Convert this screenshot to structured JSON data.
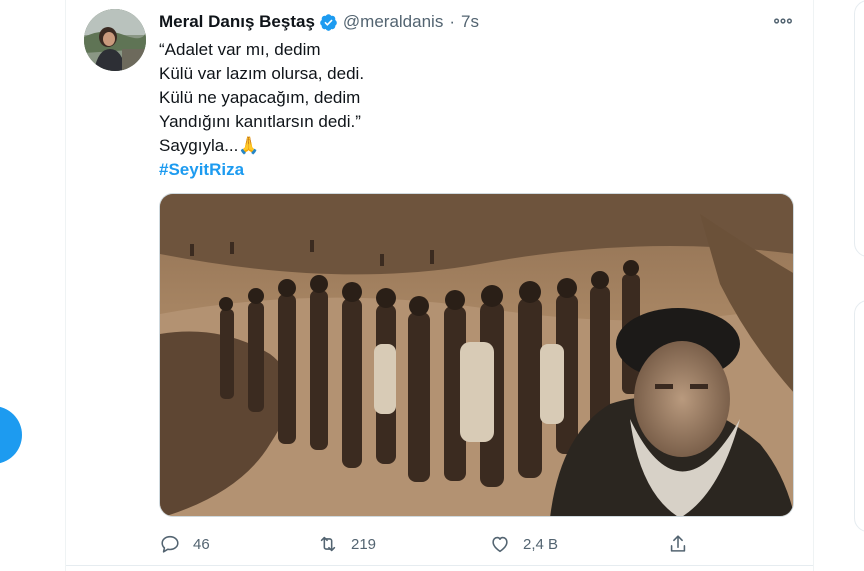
{
  "tweet": {
    "display_name": "Meral Danış Beştaş",
    "handle": "@meraldanis",
    "separator": "·",
    "time": "7s",
    "lines": [
      "“Adalet var mı, dedim",
      "Külü var lazım olursa, dedi.",
      "Külü ne yapacağım, dedim",
      "Yandığını kanıtlarsın dedi.”",
      "Saygıyla...🙏"
    ],
    "hashtag": "#SeyitRiza"
  },
  "actions": {
    "reply_count": "46",
    "retweet_count": "219",
    "like_count": "2,4 B"
  },
  "colors": {
    "accent": "#1d9bf0",
    "text": "#0f1419",
    "muted": "#536471"
  },
  "icons": [
    "verified-badge-icon",
    "more-icon",
    "reply-icon",
    "retweet-icon",
    "like-icon",
    "share-icon"
  ]
}
